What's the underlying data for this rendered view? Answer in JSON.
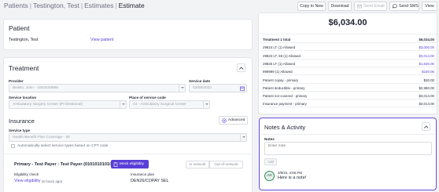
{
  "breadcrumb": {
    "patients": "Patients",
    "patient": "Testington, Test",
    "estimates": "Estimates",
    "current": "Estimate",
    "sep": "|"
  },
  "toolbar": {
    "copy": "Copy to New",
    "download": "Download",
    "send_email": "Send Email",
    "send_sms": "Send SMS",
    "view": "View"
  },
  "patient": {
    "heading": "Patient",
    "name": "Testington, Test",
    "view_link": "View patient"
  },
  "treatment": {
    "heading": "Treatment",
    "provider_label": "Provider",
    "provider_value": "Beatto, John - 1003240888",
    "date_label": "Service date",
    "date_value": "03/08/2022",
    "location_label": "Service location",
    "location_value": "Ambulatory Surgery Center (Professional)",
    "pos_label": "Place of service code",
    "pos_value": "24 - Ambulatory Surgical Center"
  },
  "insurance": {
    "heading": "Insurance",
    "advanced": "Advanced",
    "type_label": "Service type",
    "type_value": "Health Benefit Plan Coverage - 30",
    "auto_select": "Automatically select service types based on CPT code",
    "payer_title": "Primary - Test Payer : Test Payer (01010101010)",
    "mock": "Mock eligibility",
    "in_network": "In network",
    "out_network": "Out-of-network",
    "elig_label": "Eligibility check",
    "elig_link": "View eligibility",
    "elig_ago": "(6 hours ago)",
    "plan_label": "Insurance plan",
    "plan_value": "DEN26/COPAY SEL"
  },
  "summary": {
    "total": "$6,034.00",
    "rows": [
      {
        "k": "Treatment 1 total",
        "v": "$6,034.00",
        "bold": true,
        "blue": false
      },
      {
        "k": "29824 LT (1) Allowed",
        "v": "$3,000.00",
        "bold": false,
        "blue": true
      },
      {
        "k": "29823 LT, 59 (1) Allowed",
        "v": "$3,014.00",
        "bold": false,
        "blue": true
      },
      {
        "k": "29826 LT (1) Allowed",
        "v": "$1,830.00",
        "bold": false,
        "blue": true
      },
      {
        "k": "999999 (1) Allowed",
        "v": "$150.00",
        "bold": false,
        "blue": true
      },
      {
        "k": "Patient copay - primary",
        "v": "$30.00",
        "bold": false,
        "blue": false
      },
      {
        "k": "Patient deductible - primary",
        "v": "$2,980.00",
        "bold": false,
        "blue": false
      },
      {
        "k": "Patient not covered - primary",
        "v": "$3,014.00",
        "bold": false,
        "blue": false
      },
      {
        "k": "Insurance payment - primary",
        "v": "$3,014.00",
        "bold": false,
        "blue": false
      }
    ]
  },
  "notes": {
    "heading": "Notes & Activity",
    "label": "Notes",
    "placeholder": "Enter note",
    "add": "Add",
    "initials": "AR",
    "timestamp": "3/8/22, 3:56 PM",
    "body": "Here is a note!"
  },
  "colors": {
    "accent": "#5a3fd6",
    "link": "#5a3fd6",
    "notes_border": "#6a4be0"
  }
}
